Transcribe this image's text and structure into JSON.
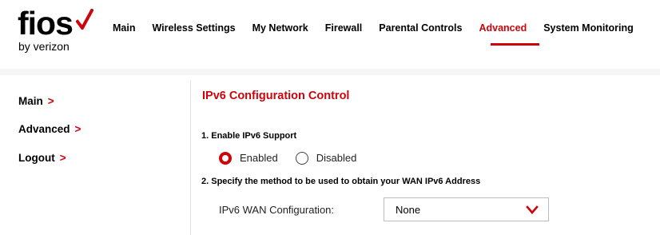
{
  "brand": {
    "logo_text": "fios",
    "logo_subtext": "by verizon",
    "accent_color": "#cd040b"
  },
  "topnav": {
    "items": [
      {
        "label": "Main",
        "active": false
      },
      {
        "label": "Wireless Settings",
        "active": false
      },
      {
        "label": "My Network",
        "active": false
      },
      {
        "label": "Firewall",
        "active": false
      },
      {
        "label": "Parental Controls",
        "active": false
      },
      {
        "label": "Advanced",
        "active": true
      },
      {
        "label": "System Monitoring",
        "active": false
      }
    ]
  },
  "sidebar": {
    "items": [
      {
        "label": "Main",
        "icon": "chevron-right-icon"
      },
      {
        "label": "Advanced",
        "icon": "chevron-right-icon"
      },
      {
        "label": "Logout",
        "icon": "chevron-right-icon"
      }
    ]
  },
  "main": {
    "title": "IPv6 Configuration Control",
    "section1_label": "1. Enable IPv6 Support",
    "radio": {
      "options": [
        {
          "label": "Enabled",
          "selected": true
        },
        {
          "label": "Disabled",
          "selected": false
        }
      ]
    },
    "section2_label": "2. Specify the method to be used to obtain your WAN IPv6 Address",
    "wan_config": {
      "label": "IPv6 WAN Configuration:",
      "value": "None",
      "icon": "chevron-down-icon"
    }
  }
}
